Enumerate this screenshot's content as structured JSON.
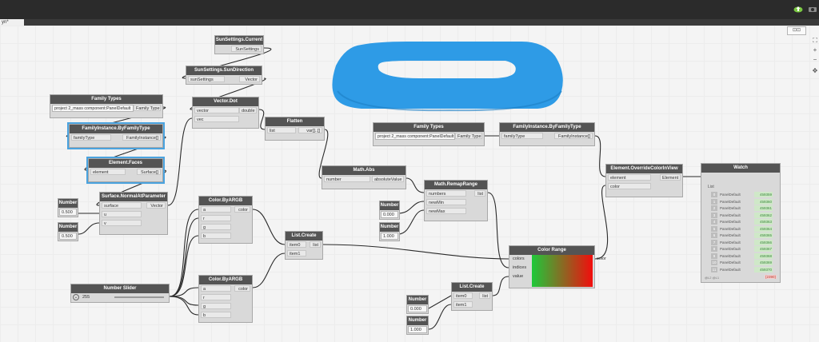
{
  "window": {
    "tab_title": "yn*"
  },
  "colors": {
    "wire": "#2a2a2a",
    "selection": "#4aa3df",
    "shape": "#2e9be6",
    "node_header": "#545454"
  },
  "nodes": {
    "sun_current": {
      "title": "SunSettings.Current",
      "out": "SunSettings"
    },
    "sun_direction": {
      "title": "SunSettings.SunDirection",
      "in": "sunSettings",
      "out": "Vector"
    },
    "vector_dot": {
      "title": "Vector.Dot",
      "in1": "vector",
      "in2": "vec",
      "out": "double"
    },
    "family_types_1": {
      "title": "Family Types",
      "value": "project 2_mass component:PanelDefault",
      "out": "Family Type"
    },
    "fam_by_type_1": {
      "title": "FamilyInstance.ByFamilyType",
      "in": "familyType",
      "out": "FamilyInstance[]"
    },
    "element_faces": {
      "title": "Element.Faces",
      "in": "element",
      "out": "Surface[]"
    },
    "normal_at": {
      "title": "Surface.NormalAtParameter",
      "in1": "surface",
      "in2": "u",
      "in3": "v",
      "out": "Vector"
    },
    "number_1": {
      "title": "Number",
      "value": "0.500"
    },
    "number_2": {
      "title": "Number",
      "value": "0.500"
    },
    "flatten": {
      "title": "Flatten",
      "in": "list",
      "out": "var[]..[]"
    },
    "family_types_2": {
      "title": "Family Types",
      "value": "project 2_mass component:PanelDefault",
      "out": "Family Type"
    },
    "fam_by_type_2": {
      "title": "FamilyInstance.ByFamilyType",
      "in": "familyType",
      "out": "FamilyInstance[]"
    },
    "override_color": {
      "title": "Element.OverrideColorInView",
      "in1": "element",
      "in2": "color",
      "out": "Element"
    },
    "math_abs": {
      "title": "Math.Abs",
      "in": "number",
      "out": "absoluteValue"
    },
    "remap": {
      "title": "Math.RemapRange",
      "in1": "numbers",
      "in2": "newMin",
      "in3": "newMax",
      "out": "list"
    },
    "number_3": {
      "title": "Number",
      "value": "0.000"
    },
    "number_4": {
      "title": "Number",
      "value": "1.000"
    },
    "color_argb_1": {
      "title": "Color.ByARGB",
      "in1": "a",
      "in2": "r",
      "in3": "g",
      "in4": "b",
      "out": "color"
    },
    "color_argb_2": {
      "title": "Color.ByARGB",
      "in1": "a",
      "in2": "r",
      "in3": "g",
      "in4": "b",
      "out": "color"
    },
    "list_create_1": {
      "title": "List.Create",
      "in1": "item0",
      "in2": "item1",
      "out": "list"
    },
    "list_create_2": {
      "title": "List.Create",
      "in1": "item0",
      "in2": "item1",
      "out": "list"
    },
    "slider": {
      "title": "Number Slider",
      "value": "255"
    },
    "color_range": {
      "title": "Color Range",
      "in1": "colors",
      "in2": "indices",
      "in3": "value",
      "out": "color"
    },
    "number_5": {
      "title": "Number",
      "value": "0.000"
    },
    "number_6": {
      "title": "Number",
      "value": "1.000"
    },
    "watch": {
      "title": "Watch",
      "list_label": "List",
      "rows": [
        {
          "idx": "0",
          "label": "PanelDefault",
          "value": "459359"
        },
        {
          "idx": "1",
          "label": "PanelDefault",
          "value": "459360"
        },
        {
          "idx": "2",
          "label": "PanelDefault",
          "value": "459361"
        },
        {
          "idx": "3",
          "label": "PanelDefault",
          "value": "459362"
        },
        {
          "idx": "4",
          "label": "PanelDefault",
          "value": "459363"
        },
        {
          "idx": "5",
          "label": "PanelDefault",
          "value": "459364"
        },
        {
          "idx": "6",
          "label": "PanelDefault",
          "value": "459365"
        },
        {
          "idx": "7",
          "label": "PanelDefault",
          "value": "459366"
        },
        {
          "idx": "8",
          "label": "PanelDefault",
          "value": "459367"
        },
        {
          "idx": "9",
          "label": "PanelDefault",
          "value": "459368"
        },
        {
          "idx": "10",
          "label": "PanelDefault",
          "value": "459369"
        },
        {
          "idx": "11",
          "label": "PanelDefault",
          "value": "459370"
        }
      ],
      "footer_left": "@L2 @L1",
      "footer_count": "{2390}"
    }
  },
  "nav": {
    "fit": "⛶",
    "zoom_in": "+",
    "zoom_out": "−",
    "pan": "✥"
  }
}
